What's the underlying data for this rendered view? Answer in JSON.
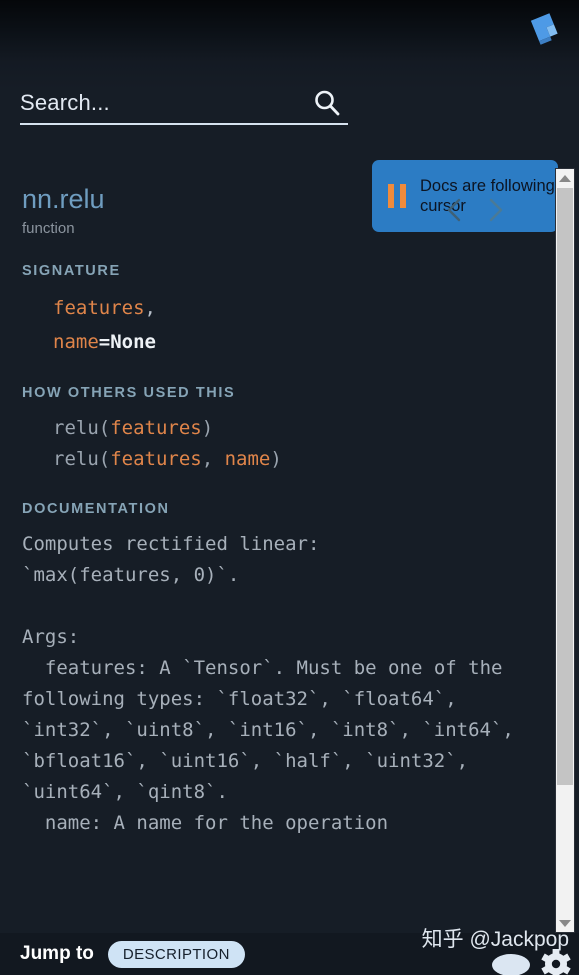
{
  "app": {
    "logo_icon": "kite-logo-icon",
    "accent_blue": "#2c7cc4",
    "orange": "#e0854a",
    "title_blue": "#6f9dc0",
    "background": "#161d26"
  },
  "search": {
    "placeholder": "Search...",
    "value": "",
    "icon": "search-icon"
  },
  "follow_button": {
    "label": "Docs are following cursor",
    "icon": "pause-icon",
    "state": "following"
  },
  "doc": {
    "title": "nn.relu",
    "kind": "function",
    "prev_icon": "chevron-left-icon",
    "next_icon": "chevron-right-icon",
    "sections": {
      "signature_heading": "SIGNATURE",
      "signature_lines": [
        {
          "ident": "features",
          "punc": ","
        },
        {
          "ident": "name",
          "punc": "=",
          "kw": "None"
        }
      ],
      "usage_heading": "HOW OTHERS USED THIS",
      "usage_lines": [
        {
          "pre": "relu(",
          "arg1": "features",
          "mid": "",
          "arg2": "",
          "post": ")"
        },
        {
          "pre": "relu(",
          "arg1": "features",
          "mid": ", ",
          "arg2": "name",
          "post": ")"
        }
      ],
      "documentation_heading": "DOCUMENTATION",
      "documentation_body": "Computes rectified linear:\n`max(features, 0)`.\n\nArgs:\n  features: A `Tensor`. Must be one of the following types: `float32`, `float64`, `int32`, `uint8`, `int16`, `int8`, `int64`, `bfloat16`, `uint16`, `half`, `uint32`, `uint64`, `qint8`.\n  name: A name for the operation"
    }
  },
  "scrollbar": {
    "up_icon": "scroll-up-arrow-icon",
    "down_icon": "scroll-down-arrow-icon"
  },
  "bottom_bar": {
    "jump_label": "Jump to",
    "jump_target": "DESCRIPTION",
    "chat_icon": "chat-bubble-icon",
    "settings_icon": "gear-icon"
  },
  "watermark": {
    "text": "知乎 @Jackpop"
  }
}
